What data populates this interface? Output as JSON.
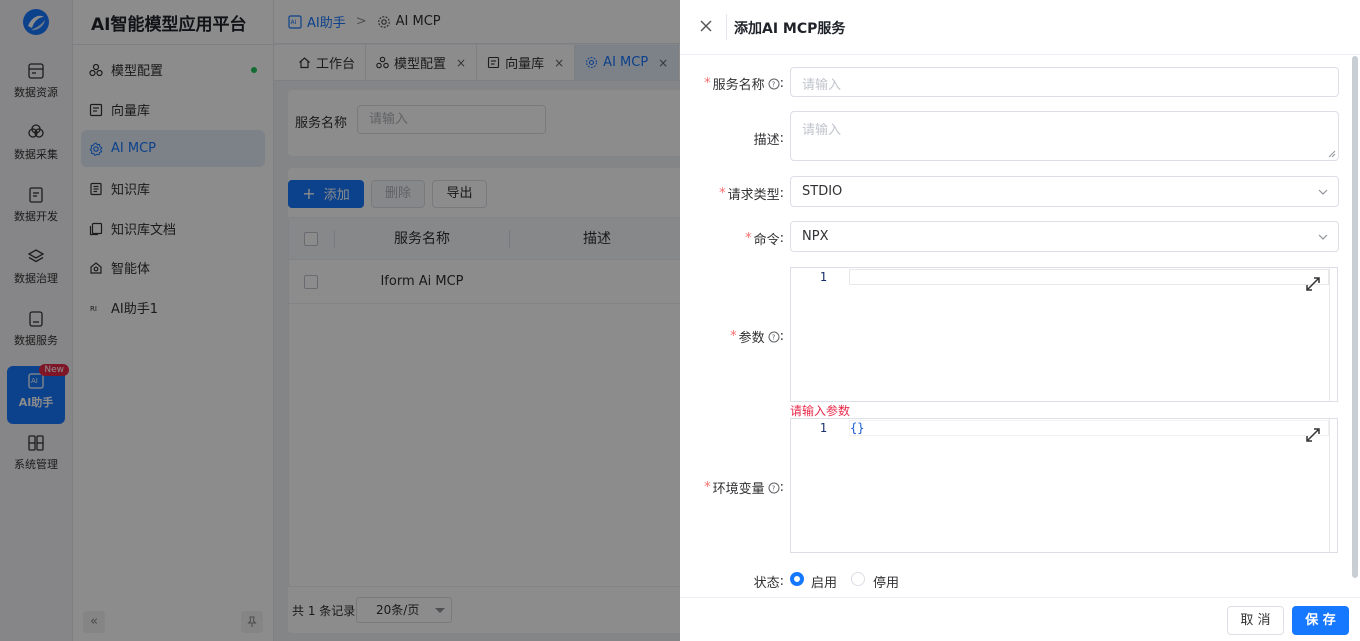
{
  "app": {
    "title": "AI智能模型应用平台"
  },
  "rail": {
    "items": [
      {
        "label": "数据资源"
      },
      {
        "label": "数据采集"
      },
      {
        "label": "数据开发"
      },
      {
        "label": "数据治理"
      },
      {
        "label": "数据服务"
      },
      {
        "label": "AI助手",
        "badge": "New",
        "active": true
      },
      {
        "label": "系统管理"
      }
    ]
  },
  "sidebar": {
    "items": [
      {
        "label": "模型配置"
      },
      {
        "label": "向量库"
      },
      {
        "label": "AI MCP",
        "active": true
      },
      {
        "label": "知识库"
      },
      {
        "label": "知识库文档"
      },
      {
        "label": "智能体"
      },
      {
        "label": "AI助手1"
      }
    ],
    "collapse_glyph": "«"
  },
  "breadcrumb": {
    "parent": "AI助手",
    "separator": ">",
    "current": "AI MCP"
  },
  "tabs": [
    {
      "label": "工作台"
    },
    {
      "label": "模型配置",
      "close": "×"
    },
    {
      "label": "向量库",
      "close": "×"
    },
    {
      "label": "AI MCP",
      "close": "×",
      "active": true
    }
  ],
  "filter": {
    "label": "服务名称",
    "placeholder": "请输入"
  },
  "toolbar": {
    "add_icon": "+",
    "add_label": "添加",
    "delete_label": "删除",
    "export_label": "导出"
  },
  "table": {
    "columns": [
      "服务名称",
      "描述"
    ],
    "rows": [
      {
        "name": "Iform Ai MCP",
        "description": ""
      }
    ]
  },
  "pager": {
    "total": "共 1 条记录",
    "page_size": "20条/页"
  },
  "drawer": {
    "title": "添加AI MCP服务",
    "close_glyph": "×",
    "fields": {
      "name": {
        "label": "服务名称",
        "required_mark": "*",
        "colon": ":",
        "placeholder": "请输入"
      },
      "description": {
        "label": "描述",
        "colon": ":",
        "placeholder": "请输入"
      },
      "request_type": {
        "label": "请求类型",
        "required_mark": "*",
        "colon": ":",
        "value": "STDIO"
      },
      "command": {
        "label": "命令",
        "required_mark": "*",
        "colon": ":",
        "value": "NPX"
      },
      "params": {
        "label": "参数",
        "required_mark": "*",
        "colon": ":",
        "line_number": "1",
        "code": "",
        "error": "请输入参数"
      },
      "env": {
        "label": "环境变量",
        "required_mark": "*",
        "colon": ":",
        "line_number": "1",
        "code": "{}"
      },
      "status": {
        "label": "状态",
        "colon": ":",
        "options": [
          "启用",
          "停用"
        ],
        "selected": "启用"
      }
    },
    "footer": {
      "cancel_label": "取 消",
      "save_label": "保 存"
    }
  },
  "colors": {
    "primary": "#1677ff",
    "danger": "#e8294a",
    "mask": "rgba(0,0,0,0.45)"
  }
}
